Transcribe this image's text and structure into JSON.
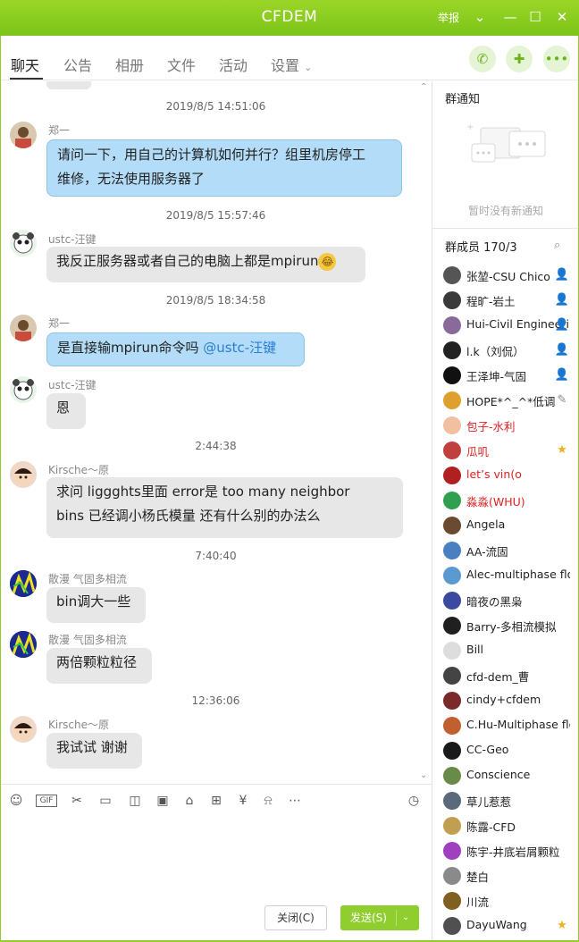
{
  "window": {
    "title": "CFDEM",
    "report": "举报"
  },
  "tabs": [
    "聊天",
    "公告",
    "相册",
    "文件",
    "活动",
    "设置"
  ],
  "messages": [
    {
      "time": "2019/8/5 14:51:06"
    },
    {
      "sender": "郑一",
      "text": "请问一下，用自己的计算机如何并行？组里机房停工维修，无法使用服务器了",
      "line1": "请问一下，用自己的计算机如何并行？组里机房停工",
      "line2": "维修，无法使用服务器了"
    },
    {
      "time": "2019/8/5 15:57:46"
    },
    {
      "sender": "ustc-汪键",
      "text": "我反正服务器或者自己的电脑上都是mpirun"
    },
    {
      "time": "2019/8/5 18:34:58"
    },
    {
      "sender": "郑一",
      "text": "是直接输mpirun命令吗 ",
      "mention": "@ustc-汪键"
    },
    {
      "sender": "ustc-汪键",
      "text": "恩"
    },
    {
      "time": "2:44:38"
    },
    {
      "sender": "Kirsche～原",
      "line1": " 求问 liggghts里面 error是 too many neighbor",
      "line2": "bins 已经调小杨氏模量 还有什么别的办法么"
    },
    {
      "time": "7:40:40"
    },
    {
      "sender": "散漫 气固多相流",
      "text": "bin调大一些"
    },
    {
      "sender": "散漫 气固多相流",
      "text": "两倍颗粒粒径"
    },
    {
      "time": "12:36:06"
    },
    {
      "sender": "Kirsche～原",
      "text": "我试试 谢谢"
    }
  ],
  "composer": {
    "close_label": "关闭(C)",
    "send_label": "发送(S)"
  },
  "side": {
    "notice_title": "群通知",
    "notice_empty": "暂时没有新通知",
    "members_title": "群成员 170/3",
    "members": [
      {
        "name": "张堃-CSU Chico",
        "red": false,
        "badge": "admin"
      },
      {
        "name": "程旷-岩土",
        "red": false,
        "badge": "admin"
      },
      {
        "name": "Hui-Civil Engineering",
        "red": false,
        "badge": "admin"
      },
      {
        "name": "l.k（刘侃）",
        "red": false,
        "badge": "admin"
      },
      {
        "name": "王泽坤-气固",
        "red": false,
        "badge": "admin"
      },
      {
        "name": "HOPE*^_^*低调",
        "red": false,
        "badge": "edit"
      },
      {
        "name": "包子-水利",
        "red": true,
        "badge": ""
      },
      {
        "name": "瓜叽",
        "red": true,
        "badge": "star"
      },
      {
        "name": "let’s vin(o",
        "red": true,
        "badge": ""
      },
      {
        "name": "淼淼(WHU)",
        "red": true,
        "badge": ""
      },
      {
        "name": " Angela",
        "red": false,
        "badge": ""
      },
      {
        "name": "AA-流固",
        "red": false,
        "badge": ""
      },
      {
        "name": "Alec-multiphase flow",
        "red": false,
        "badge": ""
      },
      {
        "name": "暗夜の黑枭",
        "red": false,
        "badge": ""
      },
      {
        "name": "Barry-多相流模拟",
        "red": false,
        "badge": ""
      },
      {
        "name": "Bill",
        "red": false,
        "badge": ""
      },
      {
        "name": "cfd-dem_曹",
        "red": false,
        "badge": ""
      },
      {
        "name": "cindy+cfdem",
        "red": false,
        "badge": ""
      },
      {
        "name": "C.Hu-Multiphase flow",
        "red": false,
        "badge": ""
      },
      {
        "name": "CC-Geo",
        "red": false,
        "badge": ""
      },
      {
        "name": "Conscience",
        "red": false,
        "badge": ""
      },
      {
        "name": "草儿惹惹",
        "red": false,
        "badge": ""
      },
      {
        "name": "陈露-CFD",
        "red": false,
        "badge": ""
      },
      {
        "name": "陈宇-井底岩屑颗粒",
        "red": false,
        "badge": ""
      },
      {
        "name": "楚白",
        "red": false,
        "badge": ""
      },
      {
        "name": "川流",
        "red": false,
        "badge": ""
      },
      {
        "name": "DayuWang",
        "red": false,
        "badge": "star"
      }
    ]
  }
}
